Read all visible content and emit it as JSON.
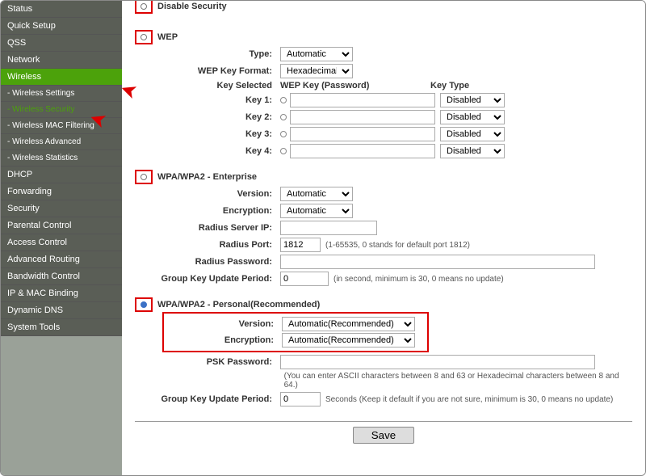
{
  "sidebar": {
    "items": [
      {
        "label": "Status"
      },
      {
        "label": "Quick Setup"
      },
      {
        "label": "QSS"
      },
      {
        "label": "Network"
      },
      {
        "label": "Wireless"
      },
      {
        "label": "Wireless Settings"
      },
      {
        "label": "Wireless Security"
      },
      {
        "label": "Wireless MAC Filtering"
      },
      {
        "label": "Wireless Advanced"
      },
      {
        "label": "Wireless Statistics"
      },
      {
        "label": "DHCP"
      },
      {
        "label": "Forwarding"
      },
      {
        "label": "Security"
      },
      {
        "label": "Parental Control"
      },
      {
        "label": "Access Control"
      },
      {
        "label": "Advanced Routing"
      },
      {
        "label": "Bandwidth Control"
      },
      {
        "label": "IP & MAC Binding"
      },
      {
        "label": "Dynamic DNS"
      },
      {
        "label": "System Tools"
      }
    ]
  },
  "main": {
    "disable_security": "Disable Security",
    "wep": {
      "title": "WEP",
      "type_label": "Type:",
      "type_value": "Automatic",
      "format_label": "WEP Key Format:",
      "format_value": "Hexadecimal",
      "key_selected": "Key Selected",
      "wep_key_header": "WEP Key (Password)",
      "key_type_header": "Key Type",
      "keys": [
        {
          "label": "Key 1:",
          "type": "Disabled"
        },
        {
          "label": "Key 2:",
          "type": "Disabled"
        },
        {
          "label": "Key 3:",
          "type": "Disabled"
        },
        {
          "label": "Key 4:",
          "type": "Disabled"
        }
      ]
    },
    "ent": {
      "title": "WPA/WPA2 - Enterprise",
      "version_label": "Version:",
      "version_value": "Automatic",
      "encryption_label": "Encryption:",
      "encryption_value": "Automatic",
      "radius_ip_label": "Radius Server IP:",
      "radius_port_label": "Radius Port:",
      "radius_port_value": "1812",
      "radius_port_hint": "(1-65535, 0 stands for default port 1812)",
      "radius_pass_label": "Radius Password:",
      "gkup_label": "Group Key Update Period:",
      "gkup_value": "0",
      "gkup_hint": "(in second, minimum is 30, 0 means no update)"
    },
    "pers": {
      "title": "WPA/WPA2 - Personal(Recommended)",
      "version_label": "Version:",
      "version_value": "Automatic(Recommended)",
      "encryption_label": "Encryption:",
      "encryption_value": "Automatic(Recommended)",
      "psk_label": "PSK Password:",
      "psk_hint": "(You can enter ASCII characters between 8 and 63 or Hexadecimal characters between 8 and 64.)",
      "gkup_label": "Group Key Update Period:",
      "gkup_value": "0",
      "gkup_hint": "Seconds (Keep it default if you are not sure, minimum is 30, 0 means no update)"
    },
    "save": "Save"
  }
}
